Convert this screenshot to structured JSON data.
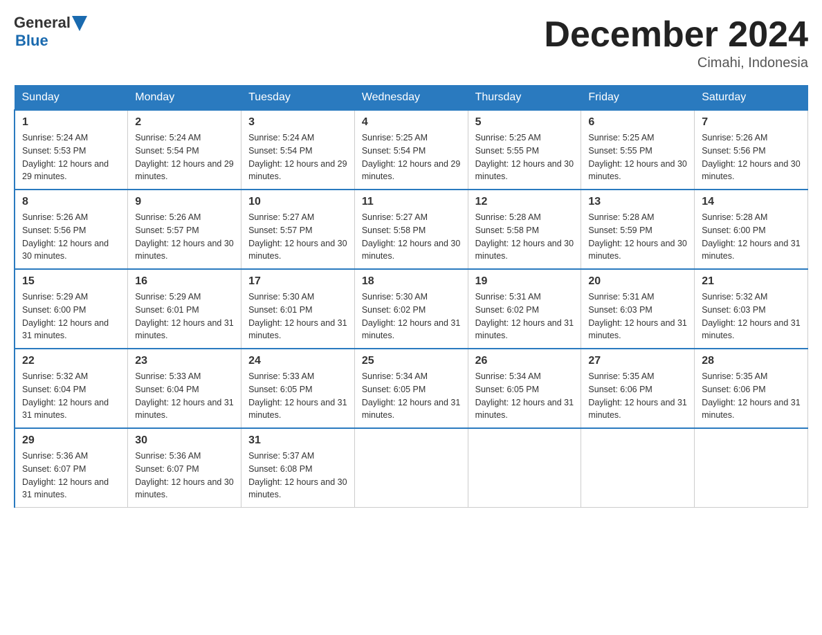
{
  "logo": {
    "general": "General",
    "blue": "Blue",
    "arrow": "▶"
  },
  "title": "December 2024",
  "location": "Cimahi, Indonesia",
  "headers": [
    "Sunday",
    "Monday",
    "Tuesday",
    "Wednesday",
    "Thursday",
    "Friday",
    "Saturday"
  ],
  "weeks": [
    [
      {
        "day": "1",
        "sunrise": "5:24 AM",
        "sunset": "5:53 PM",
        "daylight": "12 hours and 29 minutes."
      },
      {
        "day": "2",
        "sunrise": "5:24 AM",
        "sunset": "5:54 PM",
        "daylight": "12 hours and 29 minutes."
      },
      {
        "day": "3",
        "sunrise": "5:24 AM",
        "sunset": "5:54 PM",
        "daylight": "12 hours and 29 minutes."
      },
      {
        "day": "4",
        "sunrise": "5:25 AM",
        "sunset": "5:54 PM",
        "daylight": "12 hours and 29 minutes."
      },
      {
        "day": "5",
        "sunrise": "5:25 AM",
        "sunset": "5:55 PM",
        "daylight": "12 hours and 30 minutes."
      },
      {
        "day": "6",
        "sunrise": "5:25 AM",
        "sunset": "5:55 PM",
        "daylight": "12 hours and 30 minutes."
      },
      {
        "day": "7",
        "sunrise": "5:26 AM",
        "sunset": "5:56 PM",
        "daylight": "12 hours and 30 minutes."
      }
    ],
    [
      {
        "day": "8",
        "sunrise": "5:26 AM",
        "sunset": "5:56 PM",
        "daylight": "12 hours and 30 minutes."
      },
      {
        "day": "9",
        "sunrise": "5:26 AM",
        "sunset": "5:57 PM",
        "daylight": "12 hours and 30 minutes."
      },
      {
        "day": "10",
        "sunrise": "5:27 AM",
        "sunset": "5:57 PM",
        "daylight": "12 hours and 30 minutes."
      },
      {
        "day": "11",
        "sunrise": "5:27 AM",
        "sunset": "5:58 PM",
        "daylight": "12 hours and 30 minutes."
      },
      {
        "day": "12",
        "sunrise": "5:28 AM",
        "sunset": "5:58 PM",
        "daylight": "12 hours and 30 minutes."
      },
      {
        "day": "13",
        "sunrise": "5:28 AM",
        "sunset": "5:59 PM",
        "daylight": "12 hours and 30 minutes."
      },
      {
        "day": "14",
        "sunrise": "5:28 AM",
        "sunset": "6:00 PM",
        "daylight": "12 hours and 31 minutes."
      }
    ],
    [
      {
        "day": "15",
        "sunrise": "5:29 AM",
        "sunset": "6:00 PM",
        "daylight": "12 hours and 31 minutes."
      },
      {
        "day": "16",
        "sunrise": "5:29 AM",
        "sunset": "6:01 PM",
        "daylight": "12 hours and 31 minutes."
      },
      {
        "day": "17",
        "sunrise": "5:30 AM",
        "sunset": "6:01 PM",
        "daylight": "12 hours and 31 minutes."
      },
      {
        "day": "18",
        "sunrise": "5:30 AM",
        "sunset": "6:02 PM",
        "daylight": "12 hours and 31 minutes."
      },
      {
        "day": "19",
        "sunrise": "5:31 AM",
        "sunset": "6:02 PM",
        "daylight": "12 hours and 31 minutes."
      },
      {
        "day": "20",
        "sunrise": "5:31 AM",
        "sunset": "6:03 PM",
        "daylight": "12 hours and 31 minutes."
      },
      {
        "day": "21",
        "sunrise": "5:32 AM",
        "sunset": "6:03 PM",
        "daylight": "12 hours and 31 minutes."
      }
    ],
    [
      {
        "day": "22",
        "sunrise": "5:32 AM",
        "sunset": "6:04 PM",
        "daylight": "12 hours and 31 minutes."
      },
      {
        "day": "23",
        "sunrise": "5:33 AM",
        "sunset": "6:04 PM",
        "daylight": "12 hours and 31 minutes."
      },
      {
        "day": "24",
        "sunrise": "5:33 AM",
        "sunset": "6:05 PM",
        "daylight": "12 hours and 31 minutes."
      },
      {
        "day": "25",
        "sunrise": "5:34 AM",
        "sunset": "6:05 PM",
        "daylight": "12 hours and 31 minutes."
      },
      {
        "day": "26",
        "sunrise": "5:34 AM",
        "sunset": "6:05 PM",
        "daylight": "12 hours and 31 minutes."
      },
      {
        "day": "27",
        "sunrise": "5:35 AM",
        "sunset": "6:06 PM",
        "daylight": "12 hours and 31 minutes."
      },
      {
        "day": "28",
        "sunrise": "5:35 AM",
        "sunset": "6:06 PM",
        "daylight": "12 hours and 31 minutes."
      }
    ],
    [
      {
        "day": "29",
        "sunrise": "5:36 AM",
        "sunset": "6:07 PM",
        "daylight": "12 hours and 31 minutes."
      },
      {
        "day": "30",
        "sunrise": "5:36 AM",
        "sunset": "6:07 PM",
        "daylight": "12 hours and 30 minutes."
      },
      {
        "day": "31",
        "sunrise": "5:37 AM",
        "sunset": "6:08 PM",
        "daylight": "12 hours and 30 minutes."
      },
      null,
      null,
      null,
      null
    ]
  ]
}
